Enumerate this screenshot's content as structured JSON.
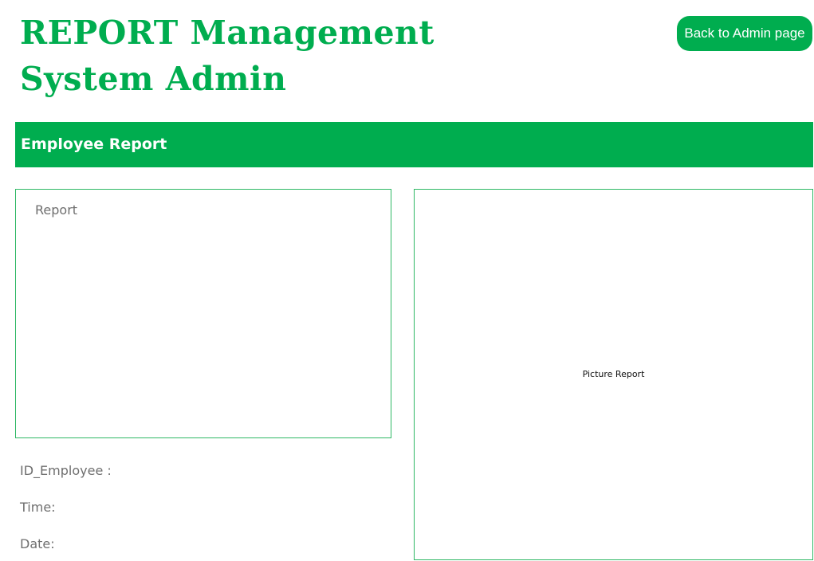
{
  "header": {
    "title_line1": "REPORT Management",
    "title_line2": "System Admin",
    "back_button_label": "Back to Admin page"
  },
  "banner": {
    "title": "Employee Report"
  },
  "report_panel": {
    "label": "Report"
  },
  "picture_panel": {
    "label": "Picture Report"
  },
  "fields": {
    "id_employee": "ID_Employee :",
    "time": "Time:",
    "date": "Date:"
  },
  "colors": {
    "brand": "#00ad4f",
    "text_muted": "#6f6f6f",
    "border": "#2fb865"
  }
}
